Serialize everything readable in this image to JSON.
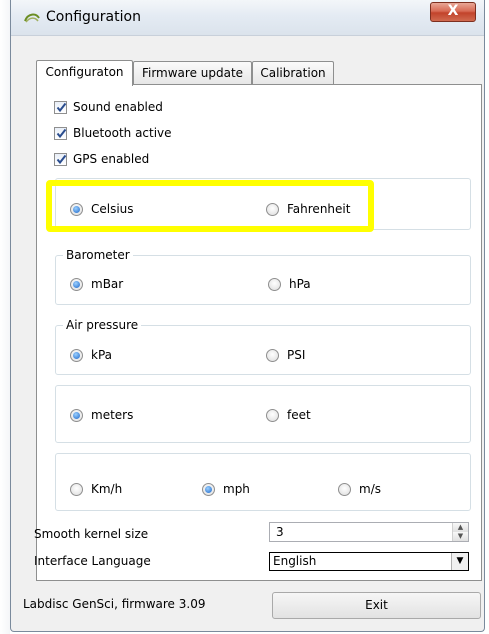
{
  "window": {
    "title": "Configuration",
    "close_label": "X"
  },
  "tabs": [
    {
      "label": "Configuraton",
      "active": true
    },
    {
      "label": "Firmware update",
      "active": false
    },
    {
      "label": "Calibration",
      "active": false
    }
  ],
  "checkboxes": [
    {
      "label": "Sound enabled",
      "checked": true
    },
    {
      "label": "Bluetooth active",
      "checked": true
    },
    {
      "label": "GPS enabled",
      "checked": true
    }
  ],
  "groups": {
    "temperature": {
      "legend": "",
      "options": [
        {
          "label": "Celsius",
          "selected": true
        },
        {
          "label": "Fahrenheit",
          "selected": false
        }
      ]
    },
    "barometer": {
      "legend": "Barometer",
      "options": [
        {
          "label": "mBar",
          "selected": true
        },
        {
          "label": "hPa",
          "selected": false
        }
      ]
    },
    "air_pressure": {
      "legend": "Air pressure",
      "options": [
        {
          "label": "kPa",
          "selected": true
        },
        {
          "label": "PSI",
          "selected": false
        }
      ]
    },
    "distance": {
      "legend": "",
      "options": [
        {
          "label": "meters",
          "selected": true
        },
        {
          "label": "feet",
          "selected": false
        }
      ]
    },
    "speed": {
      "legend": "",
      "options": [
        {
          "label": "Km/h",
          "selected": false
        },
        {
          "label": "mph",
          "selected": true
        },
        {
          "label": "m/s",
          "selected": false
        }
      ]
    }
  },
  "smooth_kernel": {
    "label": "Smooth kernel size",
    "value": "3"
  },
  "language": {
    "label": "Interface Language",
    "value": "English"
  },
  "footer": {
    "status": "Labdisc GenSci, firmware 3.09",
    "exit_label": "Exit"
  },
  "colors": {
    "highlight": "#ffff00",
    "radio_selected": "#1c66c8",
    "close_button": "#c2432b"
  },
  "icons": [
    "app-icon",
    "close-icon",
    "checkmark-icon",
    "spin-up-icon",
    "spin-down-icon",
    "dropdown-arrow-icon"
  ]
}
